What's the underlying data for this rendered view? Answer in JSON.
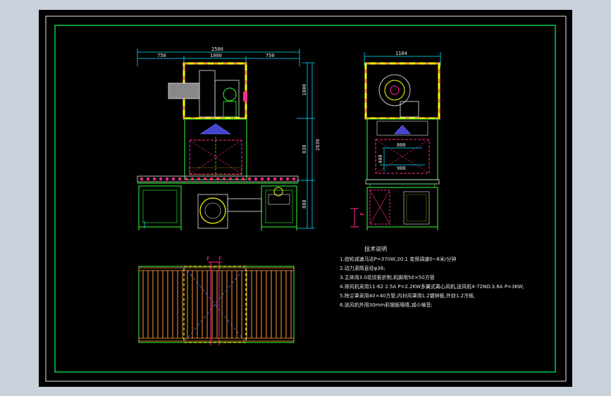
{
  "colors": {
    "background": "#000000",
    "frame": "#00ff66",
    "outline": "#e8e8e8",
    "dimension": "#00e5ff",
    "accent_yellow": "#ffff00",
    "accent_orange": "#ff9933",
    "accent_magenta": "#ff2b8c",
    "accent_blue": "#6666ff",
    "structure_green": "#33ff33"
  },
  "front_view": {
    "dims": {
      "total_width": "2500",
      "left_segment": "750",
      "middle_segment": "1000",
      "right_segment": "750",
      "upper_height": "1000",
      "middle_height": "830",
      "total_height": "2630",
      "lower_height": "800"
    }
  },
  "side_view": {
    "dims": {
      "width": "1104",
      "inner_width": "800",
      "outer_width": "900",
      "inner_height": "400"
    },
    "section_label": "F"
  },
  "plan_view": {
    "section_labels": [
      "F",
      "F"
    ]
  },
  "technical_notes": {
    "title": "技术说明",
    "items": [
      "1.齿轮减速马达P=370W,20:1 变频调速0~6米/分钟",
      "2.动力滚筒直径φ38;",
      "3.主体用3.0花纹板折制,机脚用50×50方管",
      "4.排风机采用11-62 2.5A P=2.2KW多翼式离心风机,送风机4-72NO.3.6A P=3KW;",
      "5.除尘罩采用40×40方管,内衬风罩用1.2镀锌板,外封1.2冷板,",
      "6.送风机外用30mm彩钢板隔墙,减小噪音;"
    ]
  }
}
